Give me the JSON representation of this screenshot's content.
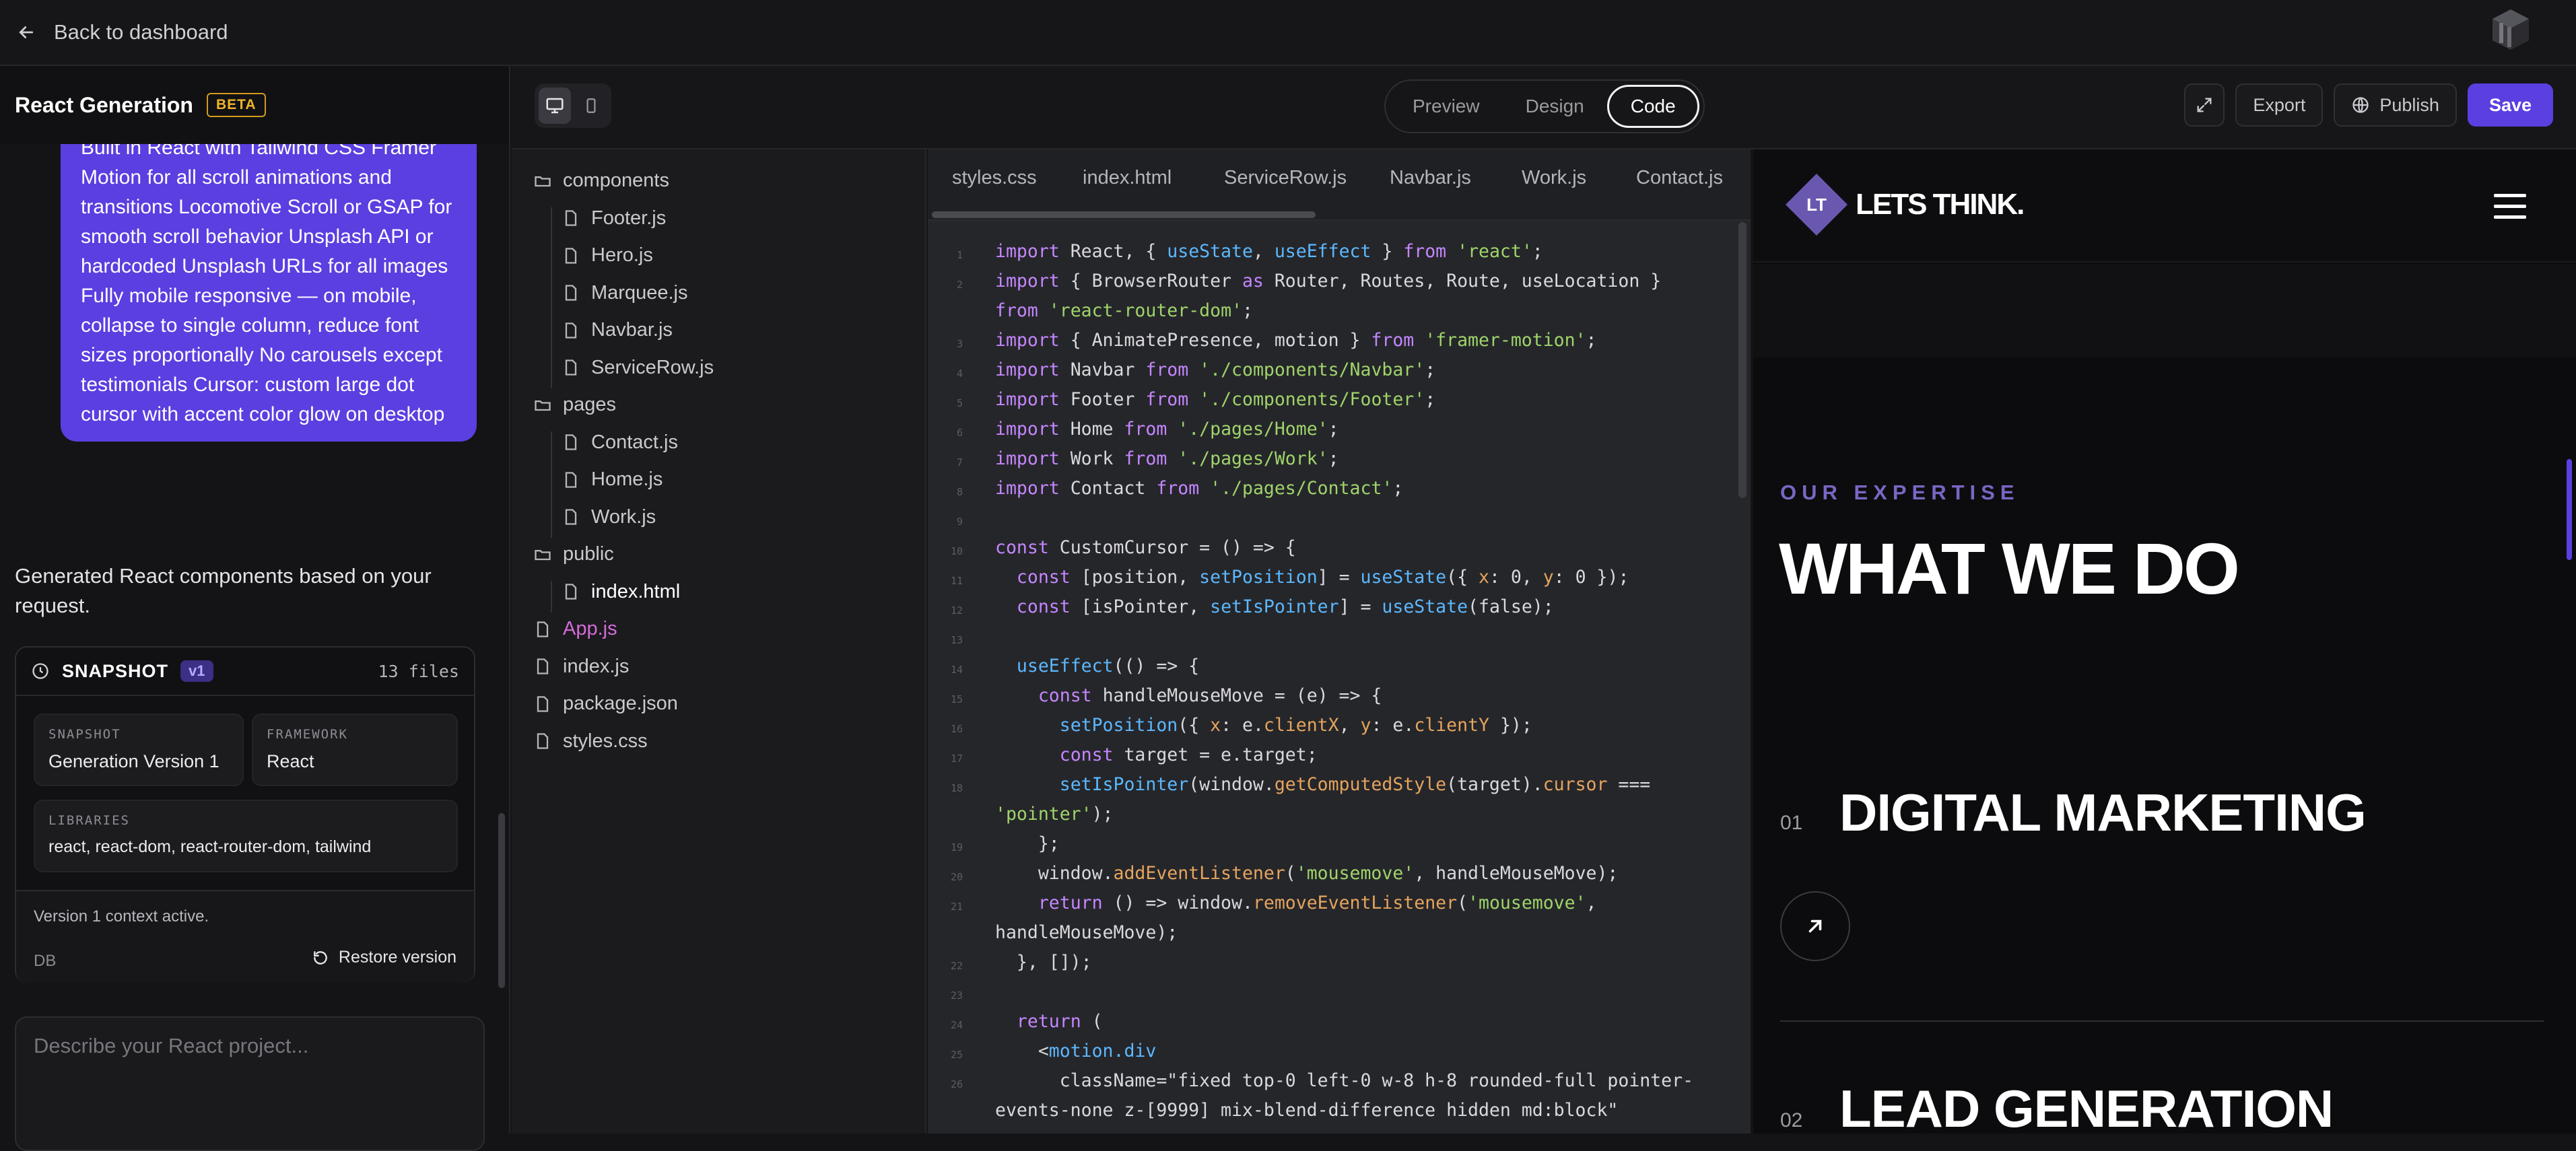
{
  "topbar": {
    "back_label": "Back to dashboard"
  },
  "sidebar": {
    "title": "React Generation",
    "badge": "BETA",
    "user_message": "Built in React with Tailwind CSS Framer Motion for all scroll animations and transitions Locomotive Scroll or GSAP for smooth scroll behavior Unsplash API or hardcoded Unsplash URLs for all images Fully mobile responsive — on mobile, collapse to single column, reduce font sizes proportionally No carousels except testimonials Cursor: custom large dot cursor with accent color glow on desktop",
    "assistant_message": "Generated React components based on your request.",
    "snapshot": {
      "title": "SNAPSHOT",
      "version": "v1",
      "files": "13 files",
      "snapshot_label": "SNAPSHOT",
      "snapshot_value": "Generation Version 1",
      "framework_label": "FRAMEWORK",
      "framework_value": "React",
      "libraries_label": "LIBRARIES",
      "libraries_value": "react, react-dom, react-router-dom, tailwind",
      "context": "Version 1 context active.",
      "db": "DB",
      "restore": "Restore version"
    },
    "prompt_placeholder": "Describe your React project..."
  },
  "toolbar": {
    "modes": [
      "Preview",
      "Design",
      "Code"
    ],
    "active_mode": "Code",
    "export": "Export",
    "publish": "Publish",
    "save": "Save"
  },
  "tree": [
    {
      "name": "components",
      "type": "folder",
      "depth": 0
    },
    {
      "name": "Footer.js",
      "type": "file",
      "depth": 1
    },
    {
      "name": "Hero.js",
      "type": "file",
      "depth": 1
    },
    {
      "name": "Marquee.js",
      "type": "file",
      "depth": 1
    },
    {
      "name": "Navbar.js",
      "type": "file",
      "depth": 1
    },
    {
      "name": "ServiceRow.js",
      "type": "file",
      "depth": 1
    },
    {
      "name": "pages",
      "type": "folder",
      "depth": 0
    },
    {
      "name": "Contact.js",
      "type": "file",
      "depth": 1
    },
    {
      "name": "Home.js",
      "type": "file",
      "depth": 1
    },
    {
      "name": "Work.js",
      "type": "file",
      "depth": 1
    },
    {
      "name": "public",
      "type": "folder",
      "depth": 0
    },
    {
      "name": "index.html",
      "type": "file",
      "depth": 1
    },
    {
      "name": "App.js",
      "type": "file",
      "depth": 0
    },
    {
      "name": "index.js",
      "type": "file",
      "depth": 0
    },
    {
      "name": "package.json",
      "type": "file",
      "depth": 0
    },
    {
      "name": "styles.css",
      "type": "file",
      "depth": 0
    }
  ],
  "editor_tabs": [
    "styles.css",
    "index.html",
    "ServiceRow.js",
    "Navbar.js",
    "Work.js",
    "Contact.js"
  ],
  "code_lines": [
    {
      "n": "1",
      "t": "import React, { useState, useEffect } from 'react';"
    },
    {
      "n": "2",
      "t": "import { BrowserRouter as Router, Routes, Route, useLocation }"
    },
    {
      "n": "",
      "t": "from 'react-router-dom';"
    },
    {
      "n": "3",
      "t": "import { AnimatePresence, motion } from 'framer-motion';"
    },
    {
      "n": "4",
      "t": "import Navbar from './components/Navbar';"
    },
    {
      "n": "5",
      "t": "import Footer from './components/Footer';"
    },
    {
      "n": "6",
      "t": "import Home from './pages/Home';"
    },
    {
      "n": "7",
      "t": "import Work from './pages/Work';"
    },
    {
      "n": "8",
      "t": "import Contact from './pages/Contact';"
    },
    {
      "n": "9",
      "t": ""
    },
    {
      "n": "10",
      "t": "const CustomCursor = () => {"
    },
    {
      "n": "11",
      "t": "  const [position, setPosition] = useState({ x: 0, y: 0 });"
    },
    {
      "n": "12",
      "t": "  const [isPointer, setIsPointer] = useState(false);"
    },
    {
      "n": "13",
      "t": ""
    },
    {
      "n": "14",
      "t": "  useEffect(() => {"
    },
    {
      "n": "15",
      "t": "    const handleMouseMove = (e) => {"
    },
    {
      "n": "16",
      "t": "      setPosition({ x: e.clientX, y: e.clientY });"
    },
    {
      "n": "17",
      "t": "      const target = e.target;"
    },
    {
      "n": "18",
      "t": "      setIsPointer(window.getComputedStyle(target).cursor ==="
    },
    {
      "n": "",
      "t": "'pointer');"
    },
    {
      "n": "19",
      "t": "    };"
    },
    {
      "n": "20",
      "t": "    window.addEventListener('mousemove', handleMouseMove);"
    },
    {
      "n": "21",
      "t": "    return () => window.removeEventListener('mousemove',"
    },
    {
      "n": "",
      "t": "handleMouseMove);"
    },
    {
      "n": "22",
      "t": "  }, []);"
    },
    {
      "n": "23",
      "t": ""
    },
    {
      "n": "24",
      "t": "  return ("
    },
    {
      "n": "25",
      "t": "    <motion.div"
    },
    {
      "n": "26",
      "t": "      className=\"fixed top-0 left-0 w-8 h-8 rounded-full pointer-"
    },
    {
      "n": "",
      "t": "events-none z-[9999] mix-blend-difference hidden md:block\""
    }
  ],
  "preview": {
    "logo_initials": "LT",
    "logo_text": "LETS THINK.",
    "eyebrow": "OUR EXPERTISE",
    "heading": "WHAT WE DO",
    "services": [
      {
        "num": "01",
        "title": "DIGITAL MARKETING"
      },
      {
        "num": "02",
        "title": "LEAD GENERATION"
      }
    ]
  },
  "colors": {
    "accent": "#5b3fe0",
    "beta": "#f0b429",
    "preview_accent": "#7a66c4"
  }
}
